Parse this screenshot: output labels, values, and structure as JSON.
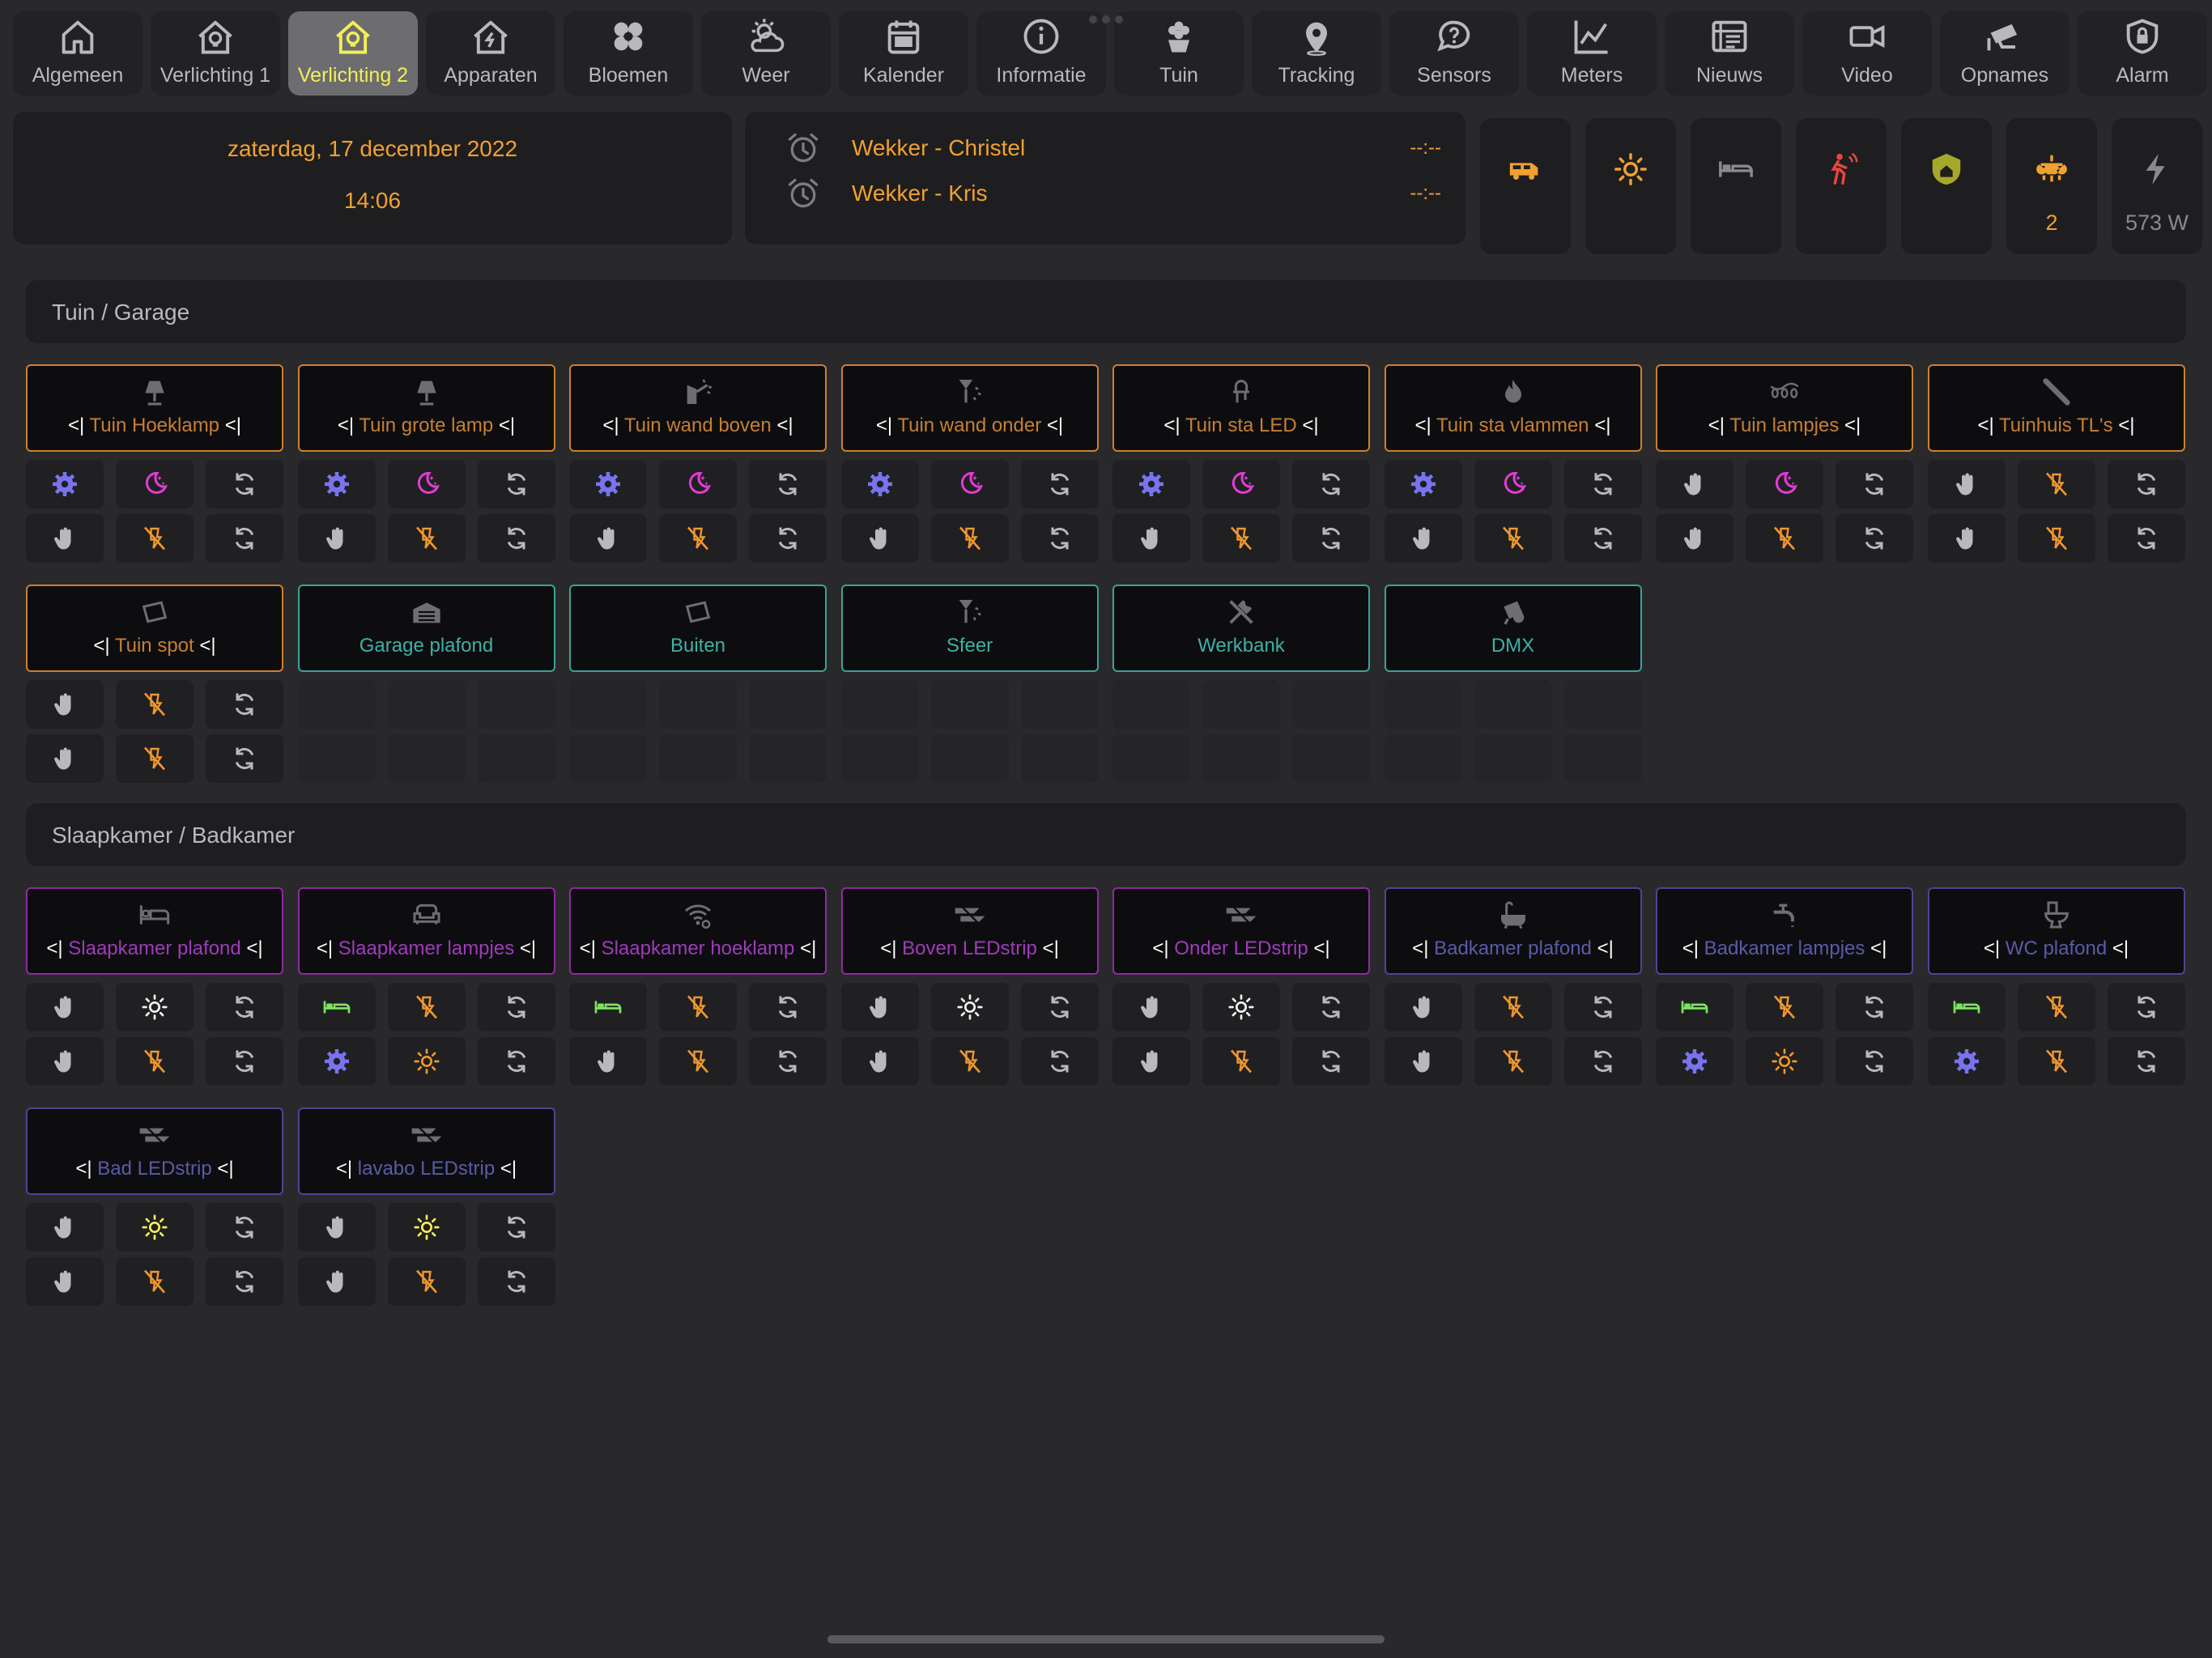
{
  "nav": {
    "tabs": [
      {
        "label": "Algemeen",
        "icon": "home-icon"
      },
      {
        "label": "Verlichting 1",
        "icon": "home-bulb-icon"
      },
      {
        "label": "Verlichting 2",
        "icon": "home-bulb-icon",
        "active": true
      },
      {
        "label": "Apparaten",
        "icon": "home-bolt-icon"
      },
      {
        "label": "Bloemen",
        "icon": "flower-icon"
      },
      {
        "label": "Weer",
        "icon": "weather-icon"
      },
      {
        "label": "Kalender",
        "icon": "calendar-icon"
      },
      {
        "label": "Informatie",
        "icon": "info-icon"
      },
      {
        "label": "Tuin",
        "icon": "flower-pot-icon"
      },
      {
        "label": "Tracking",
        "icon": "map-marker-icon"
      },
      {
        "label": "Sensors",
        "icon": "chat-icon"
      },
      {
        "label": "Meters",
        "icon": "chart-line-icon"
      },
      {
        "label": "Nieuws",
        "icon": "newspaper-icon"
      },
      {
        "label": "Video",
        "icon": "video-icon"
      },
      {
        "label": "Opnames",
        "icon": "cctv-icon"
      },
      {
        "label": "Alarm",
        "icon": "shield-lock-icon"
      }
    ]
  },
  "date": {
    "day": "zaterdag, 17 december 2022",
    "time": "14:06"
  },
  "alarms": [
    {
      "name": "Wekker - Christel",
      "value": "--:--"
    },
    {
      "name": "Wekker - Kris",
      "value": "--:--"
    }
  ],
  "status": [
    {
      "icon": "van-icon",
      "value": "",
      "color": "#f0a130"
    },
    {
      "icon": "sun-icon",
      "value": "",
      "color": "#f0a130"
    },
    {
      "icon": "bed-icon",
      "value": "",
      "color": "#8a8a8e"
    },
    {
      "icon": "motion-person-icon",
      "value": "",
      "color": "#e8463c"
    },
    {
      "icon": "shield-home-icon",
      "value": "",
      "color": "#a6a82a"
    },
    {
      "icon": "chandelier-icon",
      "value": "2",
      "color": "#f0a130"
    },
    {
      "icon": "lightning-icon",
      "value": "573 W",
      "color": "#8a8a8e"
    }
  ],
  "sections": [
    {
      "title": "Tuin / Garage"
    },
    {
      "title": "Slaapkamer / Badkamer"
    }
  ],
  "arrow_prefix": "<|",
  "arrow_suffix": "<|",
  "tiles": [
    {
      "name": "Tuin Hoeklamp",
      "icon": "lamp-icon",
      "theme": "orange",
      "arrows": true
    },
    {
      "name": "Tuin grote lamp",
      "icon": "lamp-icon",
      "theme": "orange",
      "arrows": true
    },
    {
      "name": "Tuin wand boven",
      "icon": "wall-light-up-icon",
      "theme": "orange",
      "arrows": true
    },
    {
      "name": "Tuin wand onder",
      "icon": "wall-light-down-icon",
      "theme": "orange",
      "arrows": true
    },
    {
      "name": "Tuin sta LED",
      "icon": "led-icon",
      "theme": "orange",
      "arrows": true
    },
    {
      "name": "Tuin sta vlammen",
      "icon": "fire-icon",
      "theme": "orange",
      "arrows": true
    },
    {
      "name": "Tuin lampjes",
      "icon": "string-lights-icon",
      "theme": "orange",
      "arrows": true
    },
    {
      "name": "Tuinhuis TL's",
      "icon": "tube-light-icon",
      "theme": "orange",
      "arrows": true
    },
    {
      "name": "Tuin spot",
      "icon": "spotlight-icon",
      "theme": "orange",
      "arrows": true
    },
    {
      "name": "Garage plafond",
      "icon": "garage-icon",
      "theme": "teal",
      "arrows": false
    },
    {
      "name": "Buiten",
      "icon": "spotlight-icon",
      "theme": "teal",
      "arrows": false
    },
    {
      "name": "Sfeer",
      "icon": "wall-light-down-icon",
      "theme": "teal",
      "arrows": false
    },
    {
      "name": "Werkbank",
      "icon": "tools-icon",
      "theme": "teal",
      "arrows": false
    },
    {
      "name": "DMX",
      "icon": "projector-icon",
      "theme": "teal",
      "arrows": false
    },
    {
      "name": "Slaapkamer plafond",
      "icon": "bed-outline-icon",
      "theme": "purple",
      "arrows": true
    },
    {
      "name": "Slaapkamer lampjes",
      "icon": "sofa-icon",
      "theme": "purple",
      "arrows": true
    },
    {
      "name": "Slaapkamer hoeklamp",
      "icon": "wifi-cog-icon",
      "theme": "purple",
      "arrows": true
    },
    {
      "name": "Boven LEDstrip",
      "icon": "ledstrip-icon",
      "theme": "purple",
      "arrows": true
    },
    {
      "name": "Onder LEDstrip",
      "icon": "ledstrip-icon",
      "theme": "purple",
      "arrows": true
    },
    {
      "name": "Badkamer plafond",
      "icon": "bathtub-icon",
      "theme": "indigo",
      "arrows": true
    },
    {
      "name": "Badkamer lampjes",
      "icon": "faucet-icon",
      "theme": "indigo",
      "arrows": true
    },
    {
      "name": "WC plafond",
      "icon": "toilet-icon",
      "theme": "indigo",
      "arrows": true
    },
    {
      "name": "Bad LEDstrip",
      "icon": "ledstrip-icon",
      "theme": "indigo",
      "arrows": true
    },
    {
      "name": "lavabo LEDstrip",
      "icon": "ledstrip-icon",
      "theme": "indigo",
      "arrows": true
    }
  ],
  "button_icons": {
    "cog": "cog-icon",
    "moon": "moon-icon",
    "sync": "sync-icon",
    "hand": "hand-icon",
    "light-off": "light-off-icon",
    "bed": "bed-icon",
    "sun": "sun-icon"
  },
  "colors": {
    "accent": "#f0a130",
    "blue": "#7a73f0",
    "magenta": "#e33bd8",
    "grey": "#b9b9bd",
    "white": "#f2f2f2",
    "orange": "#f0972e",
    "green": "#7be55d",
    "yellow": "#f3ee57"
  },
  "controls": [
    [
      [
        "cog:blue",
        "moon:magenta",
        "sync:grey"
      ],
      [
        "hand:grey",
        "light-off:orange",
        "sync:grey"
      ]
    ],
    [
      [
        "cog:blue",
        "moon:magenta",
        "sync:grey"
      ],
      [
        "hand:grey",
        "light-off:orange",
        "sync:grey"
      ]
    ],
    [
      [
        "cog:blue",
        "moon:magenta",
        "sync:grey"
      ],
      [
        "hand:grey",
        "light-off:orange",
        "sync:grey"
      ]
    ],
    [
      [
        "cog:blue",
        "moon:magenta",
        "sync:grey"
      ],
      [
        "hand:grey",
        "light-off:orange",
        "sync:grey"
      ]
    ],
    [
      [
        "cog:blue",
        "moon:magenta",
        "sync:grey"
      ],
      [
        "hand:grey",
        "light-off:orange",
        "sync:grey"
      ]
    ],
    [
      [
        "cog:blue",
        "moon:magenta",
        "sync:grey"
      ],
      [
        "hand:grey",
        "light-off:orange",
        "sync:grey"
      ]
    ],
    [
      [
        "hand:grey",
        "moon:magenta",
        "sync:grey"
      ],
      [
        "hand:grey",
        "light-off:orange",
        "sync:grey"
      ]
    ],
    [
      [
        "hand:grey",
        "light-off:orange",
        "sync:grey"
      ],
      [
        "hand:grey",
        "light-off:orange",
        "sync:grey"
      ]
    ],
    [
      [
        "hand:grey",
        "light-off:orange",
        "sync:grey"
      ],
      [
        "hand:grey",
        "light-off:orange",
        "sync:grey"
      ]
    ],
    [
      [
        "empty",
        "empty",
        "empty"
      ],
      [
        "empty",
        "empty",
        "empty"
      ]
    ],
    [
      [
        "empty",
        "empty",
        "empty"
      ],
      [
        "empty",
        "empty",
        "empty"
      ]
    ],
    [
      [
        "empty",
        "empty",
        "empty"
      ],
      [
        "empty",
        "empty",
        "empty"
      ]
    ],
    [
      [
        "empty",
        "empty",
        "empty"
      ],
      [
        "empty",
        "empty",
        "empty"
      ]
    ],
    [
      [
        "empty",
        "empty",
        "empty"
      ],
      [
        "empty",
        "empty",
        "empty"
      ]
    ],
    [
      [
        "hand:grey",
        "sun:white",
        "sync:grey"
      ],
      [
        "hand:grey",
        "light-off:orange",
        "sync:grey"
      ]
    ],
    [
      [
        "bed:green",
        "light-off:orange",
        "sync:grey"
      ],
      [
        "cog:blue",
        "sun:orange",
        "sync:grey"
      ]
    ],
    [
      [
        "bed:green",
        "light-off:orange",
        "sync:grey"
      ],
      [
        "hand:grey",
        "light-off:orange",
        "sync:grey"
      ]
    ],
    [
      [
        "hand:grey",
        "sun:white",
        "sync:grey"
      ],
      [
        "hand:grey",
        "light-off:orange",
        "sync:grey"
      ]
    ],
    [
      [
        "hand:grey",
        "sun:white",
        "sync:grey"
      ],
      [
        "hand:grey",
        "light-off:orange",
        "sync:grey"
      ]
    ],
    [
      [
        "hand:grey",
        "light-off:orange",
        "sync:grey"
      ],
      [
        "hand:grey",
        "light-off:orange",
        "sync:grey"
      ]
    ],
    [
      [
        "bed:green",
        "light-off:orange",
        "sync:grey"
      ],
      [
        "cog:blue",
        "sun:orange",
        "sync:grey"
      ]
    ],
    [
      [
        "bed:green",
        "light-off:orange",
        "sync:grey"
      ],
      [
        "cog:blue",
        "light-off:orange",
        "sync:grey"
      ]
    ],
    [
      [
        "hand:grey",
        "sun:yellow",
        "sync:grey"
      ],
      [
        "hand:grey",
        "light-off:orange",
        "sync:grey"
      ]
    ],
    [
      [
        "hand:grey",
        "sun:yellow",
        "sync:grey"
      ],
      [
        "hand:grey",
        "light-off:orange",
        "sync:grey"
      ]
    ]
  ]
}
